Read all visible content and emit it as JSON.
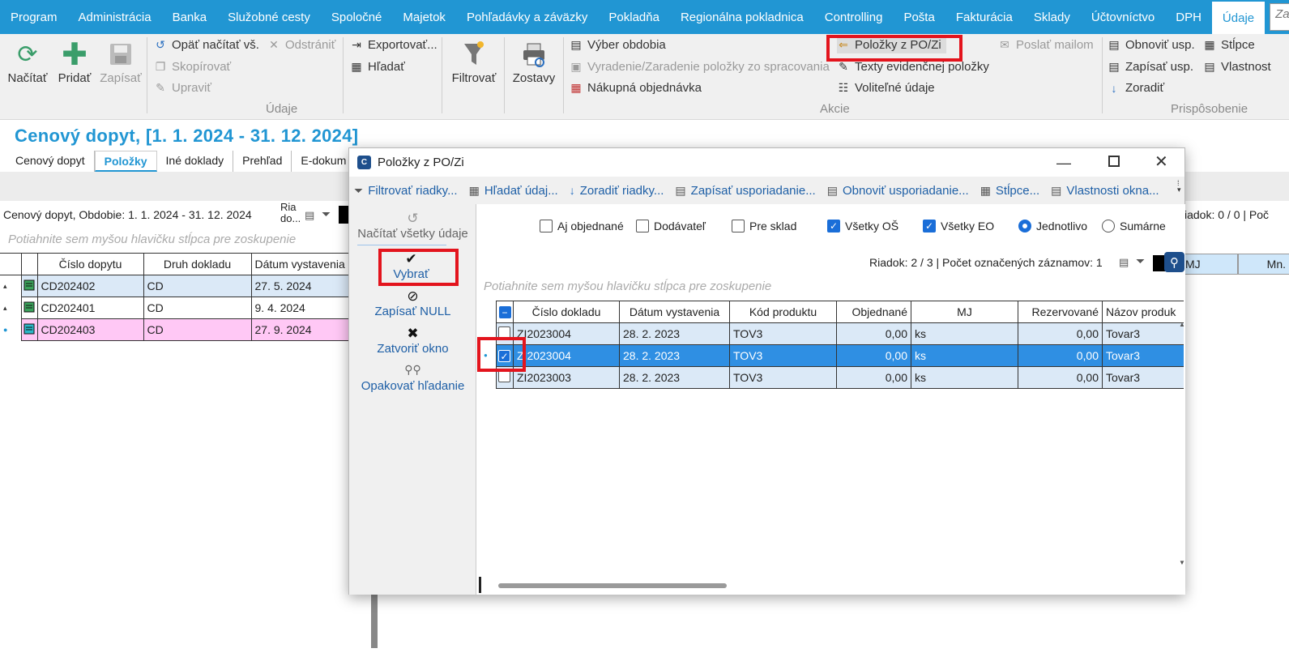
{
  "menu": {
    "items": [
      "Program",
      "Administrácia",
      "Banka",
      "Služobné cesty",
      "Spoločné",
      "Majetok",
      "Pohľadávky a záväzky",
      "Pokladňa",
      "Regionálna pokladnica",
      "Controlling",
      "Pošta",
      "Fakturácia",
      "Sklady",
      "Účtovníctvo",
      "DPH",
      "Údaje"
    ],
    "search_placeholder": "Zad"
  },
  "ribbon": {
    "nacitat": "Načítať",
    "pridat": "Pridať",
    "zapisat": "Zapísať",
    "opat_nacitat": "Opäť načítať vš.",
    "odstranit": "Odstrániť",
    "skopirovat": "Skopírovať",
    "upravit": "Upraviť",
    "exportovat": "Exportovať...",
    "hladat": "Hľadať",
    "filtrovat": "Filtrovať",
    "zostavy": "Zostavy",
    "vyber_obdobia": "Výber obdobia",
    "vyradenie": "Vyradenie/Zaradenie položky zo spracovania",
    "nakupna": "Nákupná objednávka",
    "polozky_po_zi": "Položky z PO/Zi",
    "texty": "Texty evidenčnej položky",
    "volitelne": "Voliteľné údaje",
    "poslat": "Poslať mailom",
    "obnovit_usp": "Obnoviť usp.",
    "zapisat_usp": "Zapísať usp.",
    "zoradit": "Zoradiť",
    "stlpce": "Stĺpce",
    "vlastnosti": "Vlastnost",
    "group_udaje": "Údaje",
    "group_akcie": "Akcie",
    "group_prisposobenie": "Prispôsobenie"
  },
  "page": {
    "title": "Cenový dopyt,  [1. 1. 2024 - 31. 12. 2024]",
    "tabs": [
      "Cenový dopyt",
      "Položky",
      "Iné doklady",
      "Prehľad",
      "E-dokum"
    ],
    "subheader": "Cenový dopyt, Obdobie: 1. 1. 2024 - 31. 12. 2024",
    "small_label": "Ria do...",
    "group_hint": "Potiahnite sem myšou hlavičku stĺpca pre zoskupenie",
    "table_headers": [
      "Číslo dopytu",
      "Druh dokladu",
      "Dátum vystavenia"
    ],
    "rows": [
      [
        "CD202402",
        "CD",
        "27. 5. 2024"
      ],
      [
        "CD202401",
        "CD",
        "9. 4. 2024"
      ],
      [
        "CD202403",
        "CD",
        "27. 9. 2024"
      ]
    ],
    "right_info": "iadok: 0 / 0 | Poč",
    "right_cols": [
      "MJ",
      "Mn."
    ]
  },
  "dialog": {
    "title": "Položky z PO/Zi",
    "toolbar": [
      "Filtrovať riadky...",
      "Hľadať údaj...",
      "Zoradiť riadky...",
      "Zapísať usporiadanie...",
      "Obnoviť usporiadanie...",
      "Stĺpce...",
      "Vlastnosti okna..."
    ],
    "left": {
      "nacitat_vsetky": "Načítať všetky údaje",
      "vybrat": "Vybrať",
      "zapisat_null": "Zapísať NULL",
      "zatvorit": "Zatvoriť okno",
      "opakovat": "Opakovať hľadanie"
    },
    "options": {
      "aj_objednane": "Aj objednané",
      "dodavatel": "Dodávateľ",
      "pre_sklad": "Pre sklad",
      "vsetky_os": "Všetky OŠ",
      "vsetky_eo": "Všetky EO",
      "jednotlivo": "Jednotlivo",
      "sumarne": "Sumárne"
    },
    "status": "Riadok: 2 / 3 | Počet označených záznamov: 1",
    "group_hint": "Potiahnite sem myšou hlavičku stĺpca pre zoskupenie",
    "headers": [
      "Číslo dokladu",
      "Dátum vystavenia",
      "Kód produktu",
      "Objednané",
      "MJ",
      "Rezervované",
      "Názov produk"
    ],
    "rows": [
      [
        "ZI2023004",
        "28. 2. 2023",
        "TOV3",
        "0,00",
        "ks",
        "0,00",
        "Tovar3"
      ],
      [
        "ZI2023004",
        "28. 2. 2023",
        "TOV3",
        "0,00",
        "ks",
        "0,00",
        "Tovar3"
      ],
      [
        "ZI2023003",
        "28. 2. 2023",
        "TOV3",
        "0,00",
        "ks",
        "0,00",
        "Tovar3"
      ]
    ]
  },
  "colors": {
    "accent": "#2196d3",
    "selected_row": "#2f8fe3",
    "highlight_box": "#e3141d",
    "pink_row": "#ffc8f5",
    "row_blue": "#dbe9f7"
  }
}
